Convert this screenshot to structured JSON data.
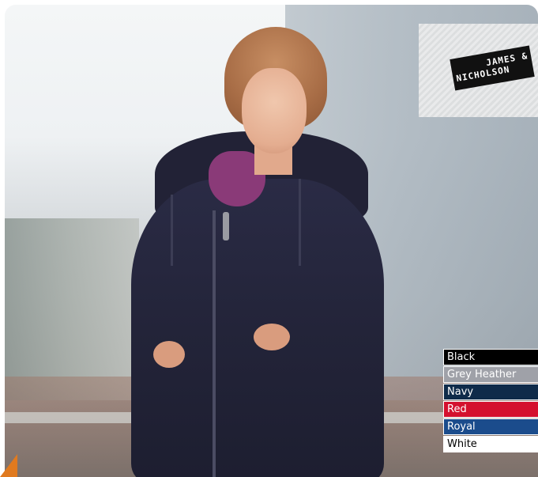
{
  "logo": {
    "line1": "JAMES &",
    "line2": "NICHOLSON"
  },
  "swatches": [
    {
      "label": "Black",
      "bg": "#000000",
      "fg": "#ffffff"
    },
    {
      "label": "Grey Heather",
      "bg": "#9fa1a8",
      "fg": "#ffffff"
    },
    {
      "label": "Navy",
      "bg": "#0f2b4a",
      "fg": "#ffffff"
    },
    {
      "label": "Red",
      "bg": "#d4102e",
      "fg": "#ffffff"
    },
    {
      "label": "Royal",
      "bg": "#1b4c8c",
      "fg": "#ffffff"
    },
    {
      "label": "White",
      "bg": "#ffffff",
      "fg": "#000000"
    }
  ]
}
